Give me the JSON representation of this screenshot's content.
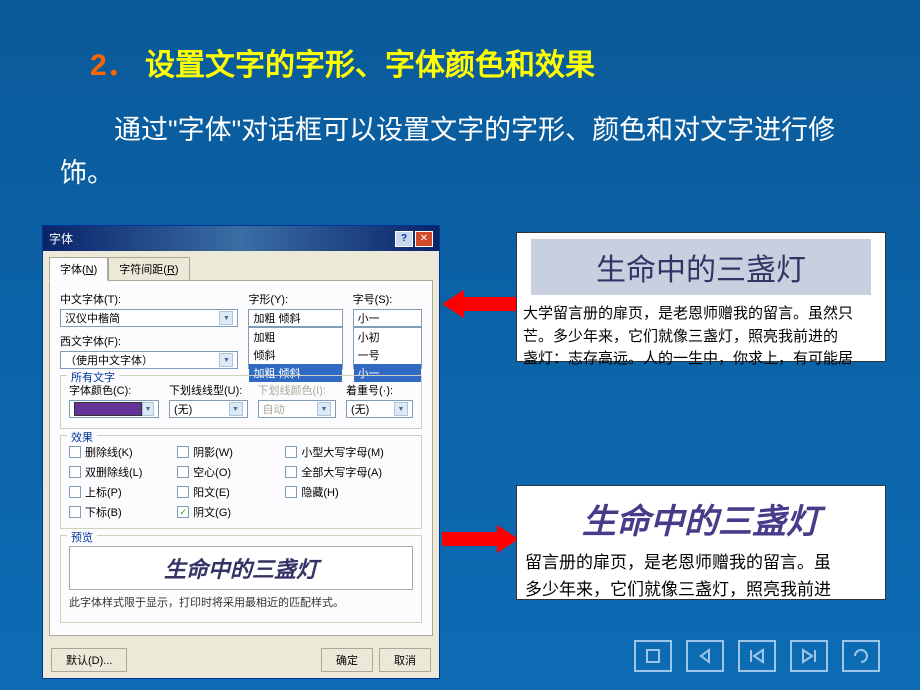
{
  "slide": {
    "number": "2．",
    "title": "设置文字的字形、字体颜色和效果",
    "body": "通过\"字体\"对话框可以设置文字的字形、颜色和对文字进行修饰。"
  },
  "dialog": {
    "title": "字体",
    "tabs": {
      "tab1": "字体",
      "tab1_key": "N",
      "tab2": "字符间距",
      "tab2_key": "R"
    },
    "labels": {
      "chinese_font": "中文字体(T):",
      "western_font": "西文字体(F):",
      "style": "字形(Y):",
      "size": "字号(S):",
      "all_text": "所有文字",
      "font_color": "字体颜色(C):",
      "underline": "下划线线型(U):",
      "underline_color": "下划线颜色(I):",
      "emphasis": "着重号(·):",
      "effects": "效果",
      "preview": "预览"
    },
    "values": {
      "chinese_font": "汉仪中楷简",
      "western_font": "（使用中文字体）",
      "style": "加粗 倾斜",
      "style_list": [
        "加粗",
        "倾斜",
        "加粗 倾斜"
      ],
      "size": "小一",
      "size_list": [
        "小初",
        "一号",
        "小一"
      ],
      "underline": "(无)",
      "underline_color": "自动",
      "emphasis": "(无)"
    },
    "effects": {
      "strike": "删除线(K)",
      "dstrike": "双删除线(L)",
      "super": "上标(P)",
      "sub": "下标(B)",
      "shadow": "阴影(W)",
      "outline": "空心(O)",
      "emboss": "阳文(E)",
      "engrave": "阴文(G)",
      "smallcaps": "小型大写字母(M)",
      "allcaps": "全部大写字母(A)",
      "hidden": "隐藏(H)"
    },
    "preview_text": "生命中的三盏灯",
    "preview_note": "此字体样式限于显示，打印时将采用最相近的匹配样式。",
    "buttons": {
      "default": "默认(D)...",
      "ok": "确定",
      "cancel": "取消"
    }
  },
  "sample1": {
    "title": "生命中的三盏灯",
    "body": "大学留言册的扉页，是老恩师赠我的留言。虽然只\n芒。多少年来，它们就像三盏灯，照亮我前进的\n盏灯：志存高远。人的一生中，你求上，有可能居"
  },
  "sample2": {
    "title": "生命中的三盏灯",
    "body": "留言册的扉页，是老恩师赠我的留言。虽\n多少年来，它们就像三盏灯，照亮我前进"
  },
  "nav": {
    "stop": "▢",
    "prev": "◁",
    "first": "|◁",
    "last": "▷|",
    "return": "↻"
  }
}
